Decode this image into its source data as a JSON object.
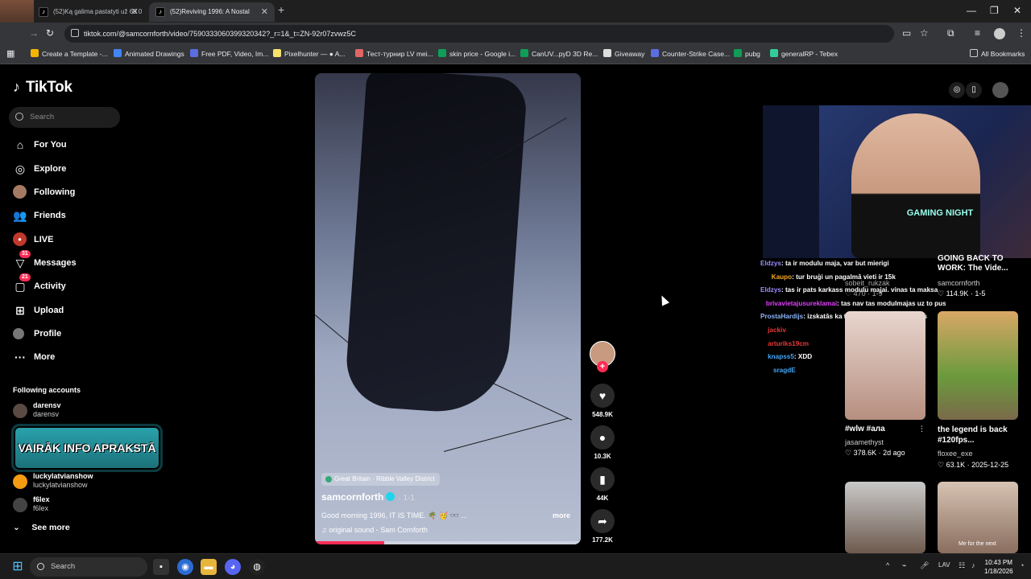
{
  "browser": {
    "tabs": [
      {
        "label": "(52)Ką galima pastatyti už 60 0",
        "favicon": "tiktok-icon"
      },
      {
        "label": "(52)Reviving 1996: A Nostal",
        "favicon": "tiktok-icon"
      }
    ],
    "new_tab": "+",
    "webcam_overlay_label": "x3",
    "url": "tiktok.com/@samcornforth/video/7590333060399320342?_r=1&_t=ZN-92r07zvwz5C",
    "bookmarks": [
      {
        "label": "Create a Template -...",
        "color": "#f4b400"
      },
      {
        "label": "Animated Drawings",
        "color": "#4285f4"
      },
      {
        "label": "Free PDF, Video, Im...",
        "color": "#5b6ee1"
      },
      {
        "label": "Pixelhunter — ● A...",
        "color": "#f7e26b"
      },
      {
        "label": "Тест-турнир LV mei...",
        "color": "#e06666"
      },
      {
        "label": "skin price - Google i...",
        "color": "#0f9d58"
      },
      {
        "label": "CanUV...pyD 3D Re...",
        "color": "#0f9d58"
      },
      {
        "label": "Giveaway",
        "color": "#dddddd"
      },
      {
        "label": "Counter-Strike Case...",
        "color": "#5b6ee1"
      },
      {
        "label": "pubg",
        "color": "#0f9d58"
      },
      {
        "label": "generalRP - Tebex",
        "color": "#3c9"
      }
    ],
    "all_bookmarks": "All Bookmarks"
  },
  "sidebar": {
    "logo": "TikTok",
    "search_placeholder": "Search",
    "nav": [
      {
        "label": "For You",
        "icon": "home-icon"
      },
      {
        "label": "Explore",
        "icon": "compass-icon"
      },
      {
        "label": "Following",
        "icon": "avatar-icon"
      },
      {
        "label": "Friends",
        "icon": "friends-icon"
      },
      {
        "label": "LIVE",
        "icon": "live-icon"
      },
      {
        "label": "Messages",
        "icon": "messages-icon",
        "badge": "31"
      },
      {
        "label": "Activity",
        "icon": "activity-icon",
        "badge": "21"
      },
      {
        "label": "Upload",
        "icon": "upload-icon"
      },
      {
        "label": "Profile",
        "icon": "profile-icon"
      },
      {
        "label": "More",
        "icon": "more-icon"
      }
    ],
    "following_title": "Following accounts",
    "accounts": [
      {
        "name": "darensv",
        "handle": "darensv"
      },
      {
        "name": "luckylatvianshow",
        "handle": "luckylatvianshow"
      },
      {
        "name": "f6lex",
        "handle": "f6lex"
      }
    ],
    "overlay_banner": "VAIRĀK INFO APRAKSTĀ",
    "see_more": "See more"
  },
  "video": {
    "location": "Great Britain · Ribble Valley District",
    "author": "samcornforth",
    "date": "· 1-1",
    "description": "Good morning 1996, IT IS TIME. 🌴 🥳 👓 ...",
    "more": "more",
    "sound": "original sound - Sam Cornforth",
    "progress": 0.26,
    "likes": "548.9K",
    "comments": "10.3K",
    "saves": "44K",
    "shares": "177.2K"
  },
  "chat": [
    {
      "user": "Eldzys",
      "color": "#9b8cff",
      "text": ": ta ir modulu maja, var but mierigi"
    },
    {
      "user": "Kaupo",
      "color": "#f5a623",
      "text": ": tur bruģi un pagalmā vieti ir 15k"
    },
    {
      "user": "Eldzys",
      "color": "#9b8cff",
      "text": ": tas ir pats karkass modulu majai. vinas ta maksa"
    },
    {
      "user": "brivavietajusureklamai",
      "color": "#e040fb",
      "text": ": tas nav tas modulmajas uz to pusi"
    },
    {
      "user": "ProstaHardijs",
      "color": "#8ab4f8",
      "text": ": izskatās ka tas saucamās dvīnu mājas"
    },
    {
      "user": "jackiv",
      "color": "#e53935",
      "text": ""
    },
    {
      "user": "arturiks19cm",
      "color": "#e53935",
      "text": ""
    },
    {
      "user": "knapss5",
      "color": "#42a5f5",
      "text": ": XDD"
    },
    {
      "user": "sragdE",
      "color": "#42a5f5",
      "text": ""
    }
  ],
  "feed": [
    {
      "title": "GOING BACK TO WORK: The Vide...",
      "author": "samcornforth",
      "stats": "♡ 114.9K · 1-5"
    },
    {
      "title": "#wlw #ала",
      "author": "jasamethyst",
      "stats": "♡ 378.6K · 2d ago"
    },
    {
      "title": "the legend is back #120fps...",
      "author": "floxee_exe",
      "stats": "♡ 63.1K · 2025-12-25"
    },
    {
      "title": "",
      "author": "sobeit_rukzak",
      "stats": "♡ 470 · 1-9"
    }
  ],
  "feed_overlay_caption": "Me for the next",
  "stream_shirt": "GAMING NIGHT",
  "taskbar": {
    "search": "Search",
    "lang": "LAV",
    "time": "10:43 PM",
    "date": "1/18/2026"
  }
}
